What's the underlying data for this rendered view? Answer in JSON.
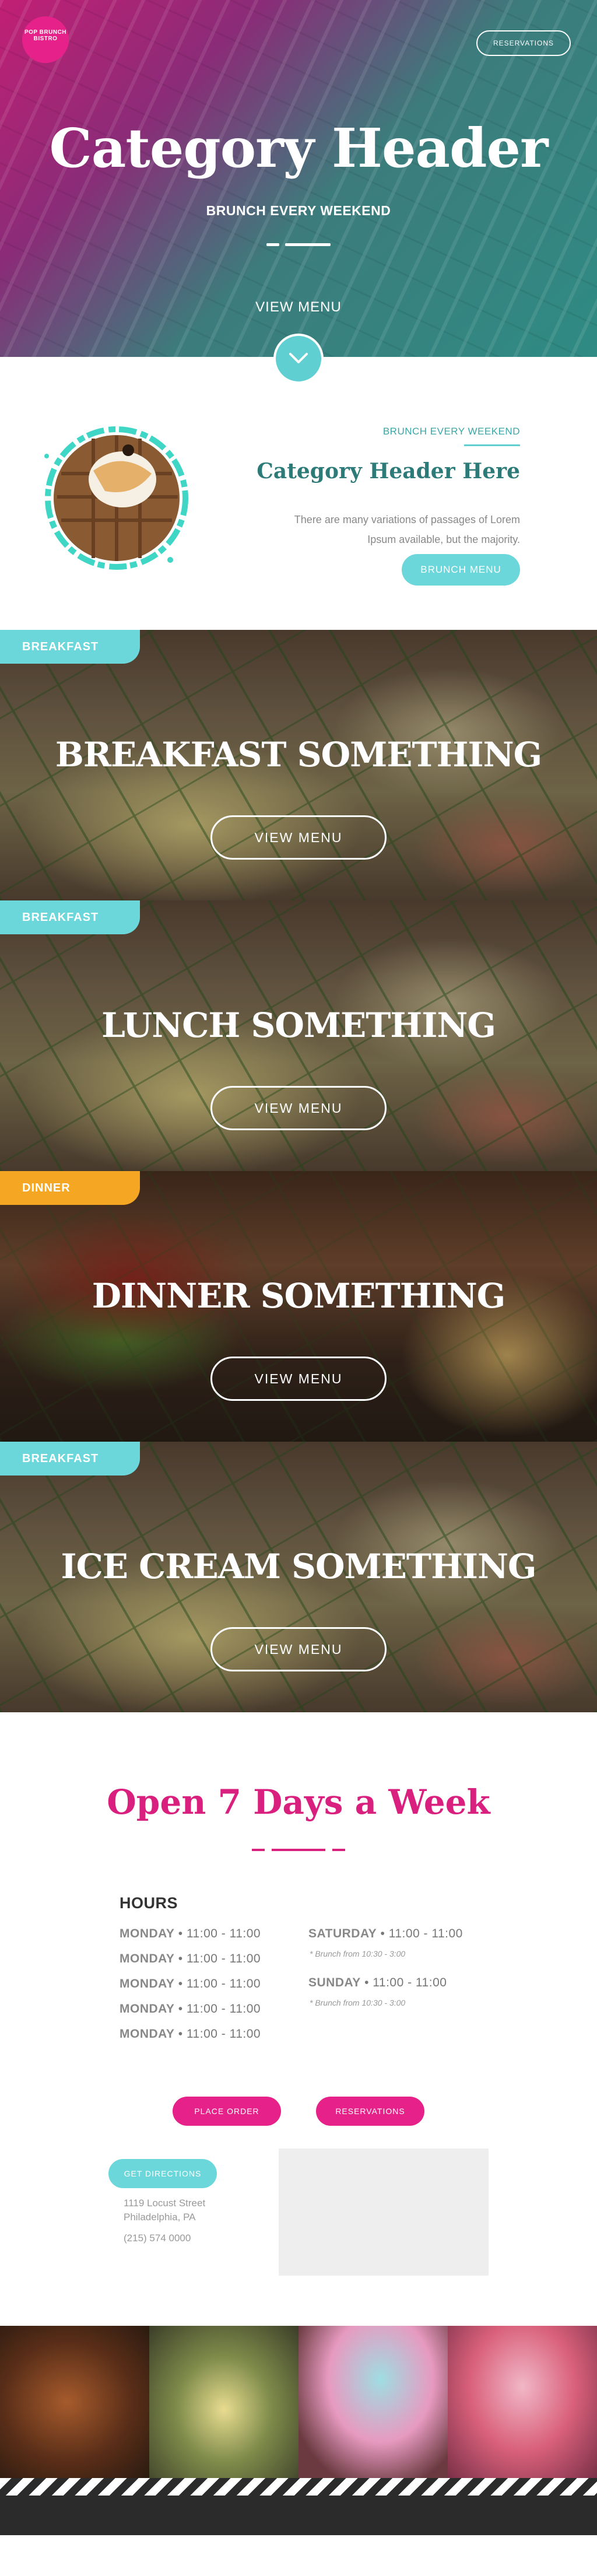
{
  "header": {
    "logo_text": "POP BRUNCH BISTRO",
    "reservations_label": "RESERVATIONS",
    "title": "Category Header",
    "subtitle": "BRUNCH EVERY WEEKEND",
    "view_menu_label": "VIEW MENU"
  },
  "intro": {
    "eyebrow": "BRUNCH EVERY WEEKEND",
    "title": "Category Header Here",
    "body": "There are many variations of passages of Lorem Ipsum available, but the majority.",
    "button_label": "BRUNCH MENU"
  },
  "menus": [
    {
      "tag": "BREAKFAST",
      "tag_color": "#6cd7da",
      "title": "BREAKFAST SOMETHING",
      "button_label": "VIEW MENU"
    },
    {
      "tag": "BREAKFAST",
      "tag_color": "#6cd7da",
      "title": "LUNCH  SOMETHING",
      "button_label": "VIEW MENU"
    },
    {
      "tag": "DINNER",
      "tag_color": "#f5a623",
      "title": "DINNER SOMETHING",
      "button_label": "VIEW MENU"
    },
    {
      "tag": "BREAKFAST",
      "tag_color": "#6cd7da",
      "title": "ICE CREAM SOMETHING",
      "button_label": "VIEW MENU"
    }
  ],
  "hours": {
    "title": "Open 7 Days a Week",
    "label": "HOURS",
    "weekdays": [
      {
        "day": "MONDAY",
        "time": "11:00 - 11:00"
      },
      {
        "day": "MONDAY",
        "time": "11:00 - 11:00"
      },
      {
        "day": "MONDAY",
        "time": "11:00 - 11:00"
      },
      {
        "day": "MONDAY",
        "time": "11:00 - 11:00"
      },
      {
        "day": "MONDAY",
        "time": "11:00 - 11:00"
      }
    ],
    "weekend": [
      {
        "day": "SATURDAY",
        "time": "11:00 - 11:00",
        "note": "* Brunch from 10:30 - 3:00"
      },
      {
        "day": "SUNDAY",
        "time": "11:00 - 11:00",
        "note": "* Brunch from 10:30 - 3:00"
      }
    ],
    "place_order_label": "PLACE ORDER",
    "reservations_label": "RESERVATIONS"
  },
  "location": {
    "directions_label": "GET DIRECTIONS",
    "street": "1119 Locust Street",
    "city": "Philadelphia, PA",
    "phone": "(215) 574 0000"
  },
  "colors": {
    "primary_pink": "#d9207f",
    "teal": "#6cd7da",
    "orange": "#f5a623"
  }
}
